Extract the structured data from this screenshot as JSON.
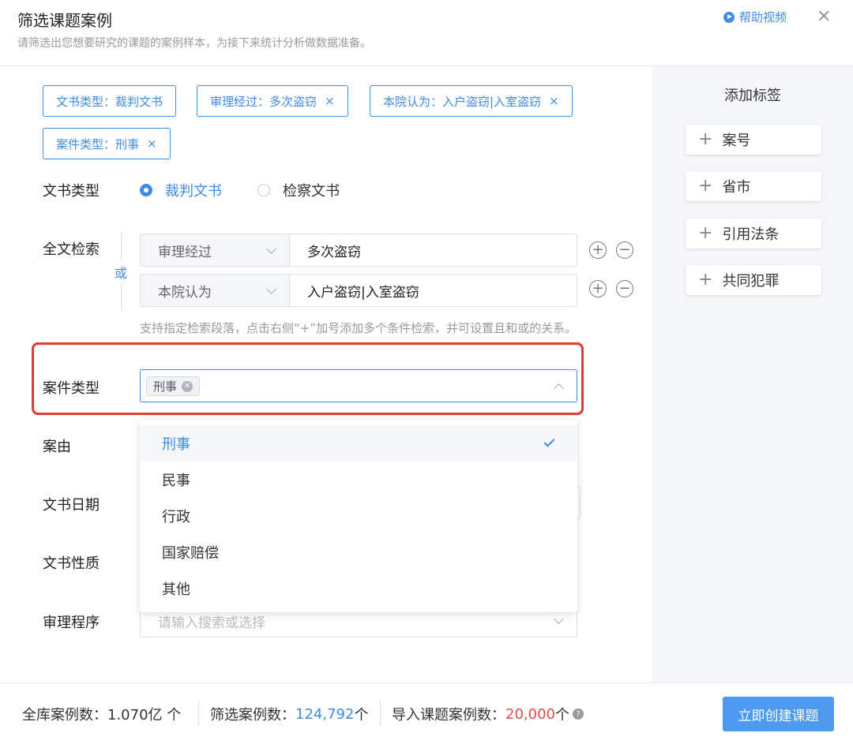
{
  "header": {
    "title": "筛选课题案例",
    "subtitle": "请筛选出您想要研究的课题的案例样本，为接下来统计分析做数据准备。",
    "help_label": "帮助视频"
  },
  "chips": [
    {
      "text": "文书类型：裁判文书"
    },
    {
      "text": "审理经过：多次盗窃",
      "close": "×"
    },
    {
      "text": "本院认为：入户盗窃|入室盗窃",
      "close": "×"
    },
    {
      "text": "案件类型：刑事",
      "close": "×"
    }
  ],
  "doc_type": {
    "label": "文书类型",
    "options": [
      {
        "label": "裁判文书",
        "selected": true
      },
      {
        "label": "检察文书",
        "selected": false
      }
    ]
  },
  "fulltext": {
    "label": "全文检索",
    "or_label": "或",
    "rows": [
      {
        "field": "审理经过",
        "value": "多次盗窃"
      },
      {
        "field": "本院认为",
        "value": "入户盗窃|入室盗窃"
      }
    ],
    "hint": "支持指定检索段落，点击右侧“+”加号添加多个条件检索，并可设置且和或的关系。"
  },
  "case_type": {
    "label": "案件类型",
    "tag": "刑事",
    "options": [
      "刑事",
      "民事",
      "行政",
      "国家赔偿",
      "其他"
    ],
    "selected": "刑事"
  },
  "labels": {
    "case_cause": "案由",
    "doc_date": "文书日期",
    "doc_nature": "文书性质",
    "procedure": "审理程序"
  },
  "procedure": {
    "placeholder": "请输入搜索或选择"
  },
  "sidebar": {
    "title": "添加标签",
    "buttons": [
      "案号",
      "省市",
      "引用法条",
      "共同犯罪"
    ]
  },
  "footer": {
    "total_label": "全库案例数：",
    "total_value": "1.070亿 个",
    "filtered_label": "筛选案例数：",
    "filtered_value": "124,792",
    "filtered_unit": "个",
    "imported_label": "导入课题案例数：",
    "imported_value": "20,000",
    "imported_unit": "个",
    "create_button": "立即创建课题"
  },
  "colors": {
    "accent": "#3f8ce8",
    "highlight": "#e53935",
    "warning": "#e04d4d"
  }
}
